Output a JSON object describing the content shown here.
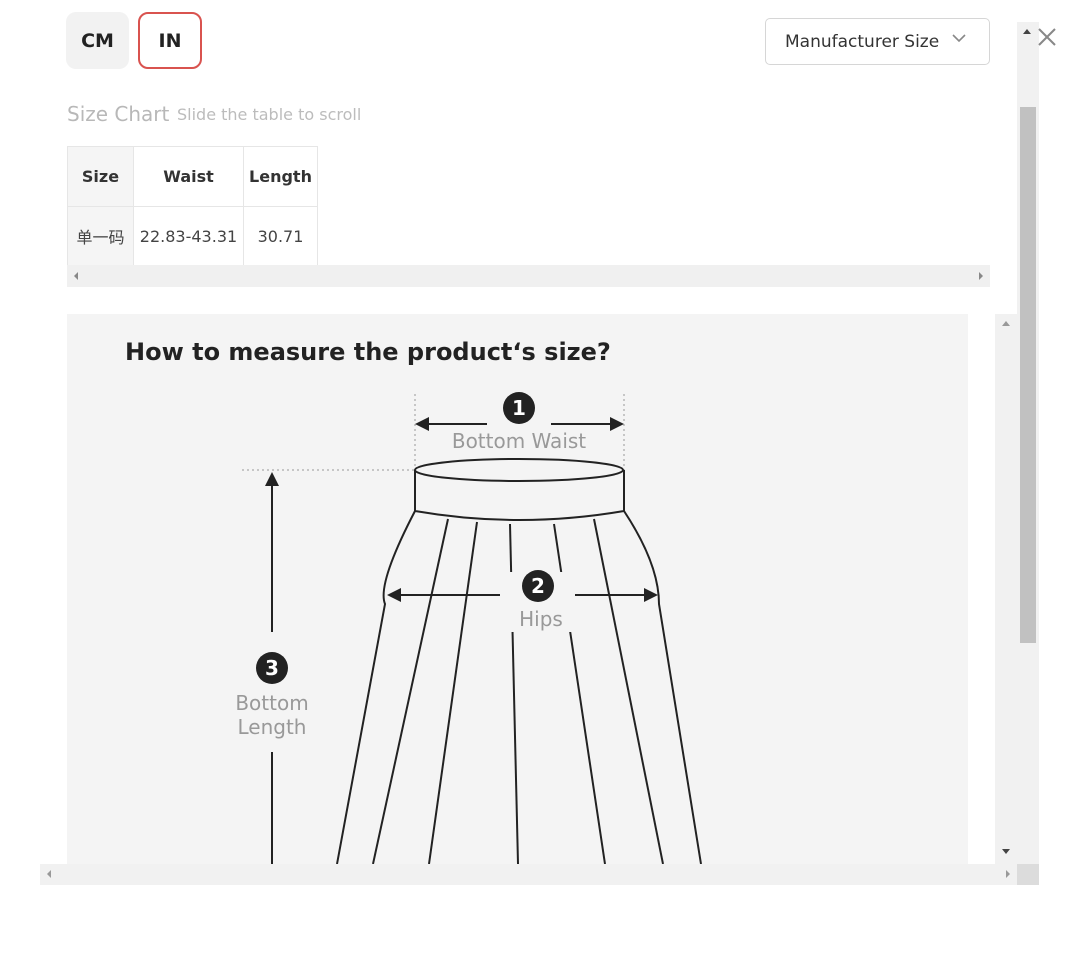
{
  "units": {
    "cm_label": "CM",
    "in_label": "IN",
    "selected": "IN"
  },
  "size_select": {
    "value": "Manufacturer Size"
  },
  "size_chart": {
    "title": "Size Chart",
    "hint": "Slide the table to scroll",
    "columns": [
      "Size",
      "Waist",
      "Length"
    ],
    "rows": [
      [
        "单一码",
        "22.83-43.31",
        "30.71"
      ]
    ]
  },
  "measure_image": {
    "title": "How to measure the product‘s size?",
    "markers": [
      {
        "number": "1",
        "label": "Bottom Waist"
      },
      {
        "number": "2",
        "label": "Hips"
      },
      {
        "number": "3",
        "label_line1": "Bottom",
        "label_line2": "Length"
      }
    ]
  },
  "colors": {
    "accent": "#d9534f",
    "muted_text": "#b8b8b8",
    "panel_bg": "#f4f4f4",
    "scroll_thumb": "#c1c1c1"
  },
  "icons": {
    "close": "close-icon",
    "dropdown": "chevron-down-icon"
  }
}
